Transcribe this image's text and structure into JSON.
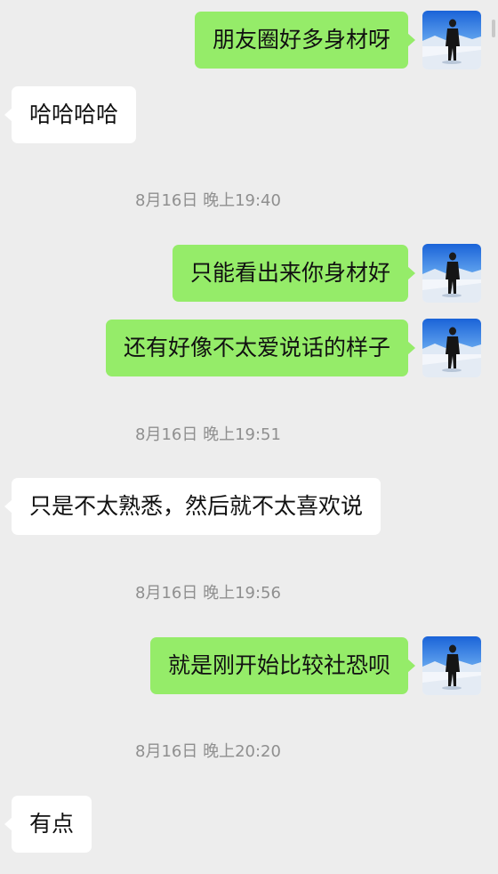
{
  "messages": [
    {
      "side": "out",
      "text": "朋友圈好多身材呀"
    },
    {
      "side": "in",
      "text": "哈哈哈哈"
    },
    {
      "time": "8月16日 晚上19:40"
    },
    {
      "side": "out",
      "text": "只能看出来你身材好"
    },
    {
      "side": "out",
      "text": "还有好像不太爱说话的样子"
    },
    {
      "time": "8月16日 晚上19:51"
    },
    {
      "side": "in",
      "text": "只是不太熟悉，然后就不太喜欢说"
    },
    {
      "time": "8月16日 晚上19:56"
    },
    {
      "side": "out",
      "text": "就是刚开始比较社恐呗"
    },
    {
      "time": "8月16日 晚上20:20"
    },
    {
      "side": "in",
      "text": "有点"
    }
  ],
  "colors": {
    "background": "#ededed",
    "outgoing_bubble": "#95ec69",
    "incoming_bubble": "#ffffff",
    "timestamp_text": "#8f8f8f"
  },
  "icons": {
    "avatar": "snow-scene-profile-photo"
  }
}
